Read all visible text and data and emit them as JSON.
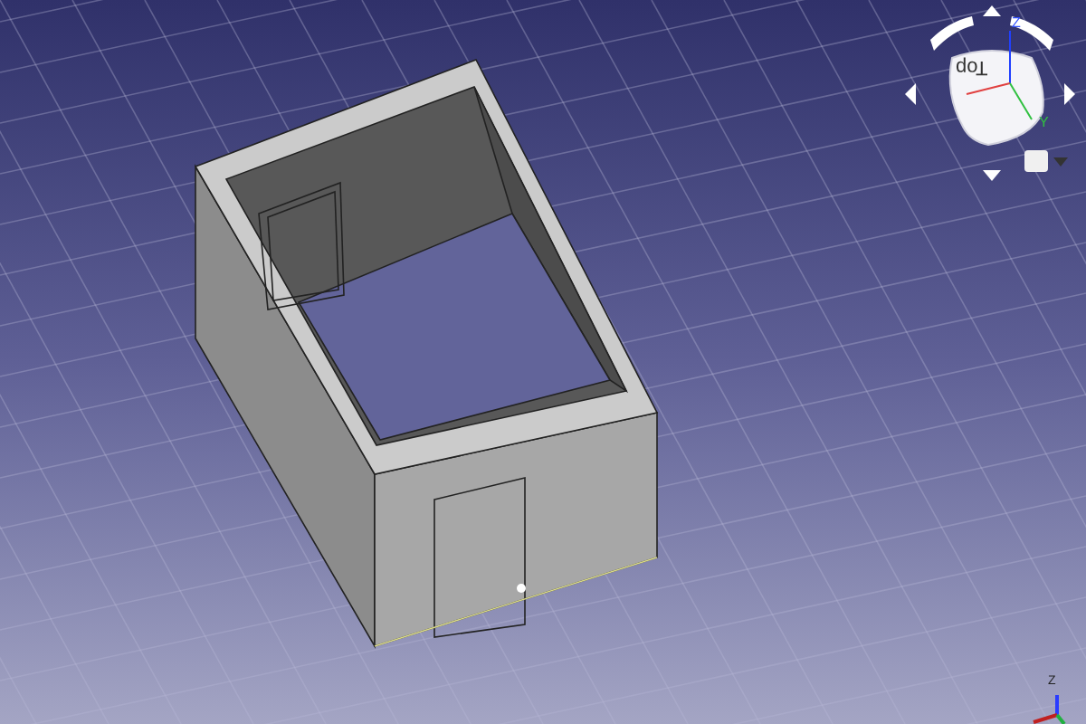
{
  "nav_cube": {
    "face_label": "Top",
    "axis_labels": [
      "Z",
      "Y"
    ]
  },
  "corner_axes": {
    "label": "Z"
  }
}
